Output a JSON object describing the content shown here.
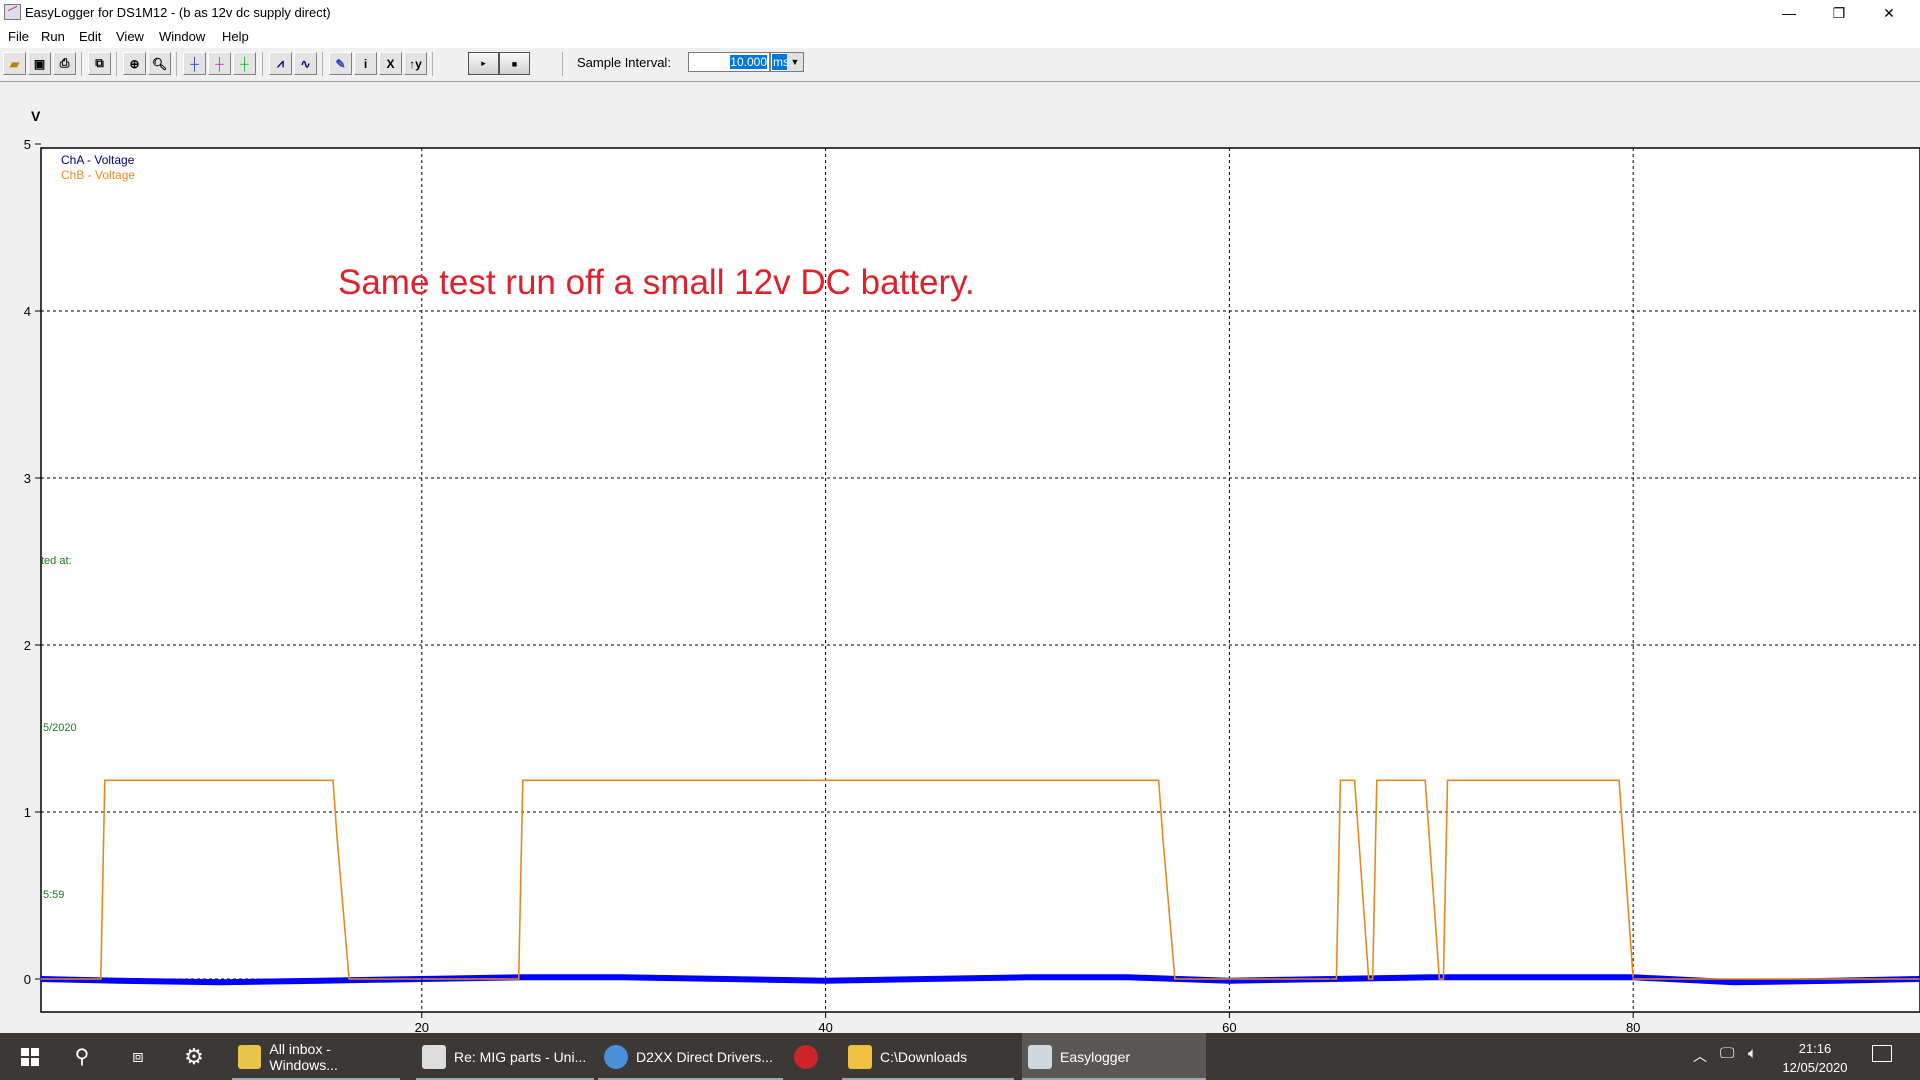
{
  "window": {
    "title": "EasyLogger for DS1M12 - (b as 12v dc supply direct)",
    "controls": [
      "minimize",
      "restore",
      "close"
    ]
  },
  "menu": [
    "File",
    "Run",
    "Edit",
    "View",
    "Window",
    "Help"
  ],
  "toolbar": {
    "buttons": [
      "open-icon",
      "save-icon",
      "print-icon",
      "copy-icon",
      "zoom-in-icon",
      "zoom-icon",
      "cursor-blue-icon",
      "cursor-magenta-icon",
      "cursor-green-icon",
      "trace-step-icon",
      "trace-smooth-icon",
      "notes-icon",
      "info-icon",
      "x-axis-icon",
      "y-axis-icon"
    ],
    "run_label": "▸",
    "stop_label": "■",
    "sample_interval_label": "Sample Interval:",
    "sample_interval_value": "10.000",
    "sample_interval_unit": "ms"
  },
  "plot": {
    "y_unit": "V",
    "side_text": [
      "ted at:",
      "5/2020",
      "5:59"
    ],
    "annotation": "Same test run off a small 12v DC battery.",
    "annotation_color": "#e0202a"
  },
  "chart_data": {
    "type": "line",
    "title": "",
    "xlabel": "",
    "ylabel": "V",
    "xlim": [
      1.1,
      94.2
    ],
    "ylim": [
      -0.2,
      5
    ],
    "x_ticks": [
      20,
      40,
      60,
      80
    ],
    "y_ticks": [
      0,
      1,
      2,
      3,
      4,
      5
    ],
    "grid": true,
    "legend": "top-left",
    "series": [
      {
        "name": "ChA - Voltage",
        "color": "#0000ff",
        "legend_color": "#000080",
        "x": [
          1.1,
          5,
          10,
          15,
          20,
          25,
          30,
          35,
          40,
          45,
          50,
          55,
          60,
          65,
          70,
          75,
          80,
          85,
          90,
          94.2
        ],
        "y": [
          0.0,
          -0.01,
          -0.02,
          -0.01,
          0.0,
          0.01,
          0.01,
          0.0,
          -0.01,
          0.0,
          0.01,
          0.01,
          -0.01,
          0.0,
          0.01,
          0.01,
          0.01,
          -0.02,
          -0.01,
          0.0
        ]
      },
      {
        "name": "ChB - Voltage",
        "color": "#e58a1f",
        "x": [
          1.1,
          4.1,
          4.3,
          15.6,
          15.8,
          16.4,
          24.8,
          25.0,
          56.5,
          56.7,
          57.3,
          65.3,
          65.5,
          66.2,
          66.9,
          67.1,
          67.3,
          69.7,
          70.4,
          70.6,
          70.8,
          79.3,
          79.5,
          80.0,
          94.2
        ],
        "y": [
          0.0,
          0.0,
          1.19,
          1.19,
          0.85,
          0.0,
          0.0,
          1.19,
          1.19,
          0.85,
          0.0,
          0.0,
          1.19,
          1.19,
          0.0,
          0.0,
          1.19,
          1.19,
          0.0,
          0.0,
          1.19,
          1.19,
          0.85,
          0.0,
          0.0
        ]
      }
    ]
  },
  "taskbar": {
    "items": [
      {
        "label": "All inbox - Windows...",
        "icon": "mail-icon"
      },
      {
        "label": "Re: MIG parts - Uni...",
        "icon": "message-icon"
      },
      {
        "label": "D2XX Direct Drivers...",
        "icon": "chrome-icon"
      },
      {
        "label": "",
        "icon": "opera-icon"
      },
      {
        "label": "C:\\Downloads",
        "icon": "folder-icon"
      },
      {
        "label": "Easylogger",
        "icon": "easylogger-icon",
        "active": true
      }
    ],
    "time": "21:16",
    "date": "12/05/2020"
  }
}
